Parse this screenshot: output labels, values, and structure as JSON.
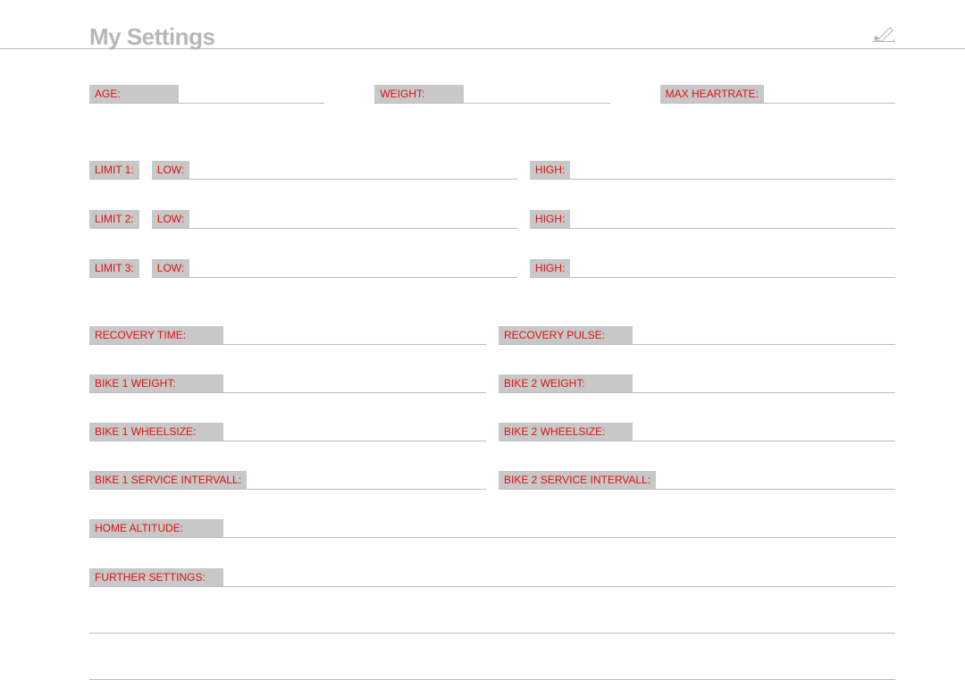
{
  "header": {
    "title": "My Settings"
  },
  "row1": {
    "age": "AGE:",
    "weight": "WEIGHT:",
    "max_hr": "MAX HEARTRATE:"
  },
  "limits": [
    {
      "tag": "LIMIT 1:",
      "low": "LOW:",
      "high": "HIGH:"
    },
    {
      "tag": "LIMIT 2:",
      "low": "LOW:",
      "high": "HIGH:"
    },
    {
      "tag": "LIMIT 3:",
      "low": "LOW:",
      "high": "HIGH:"
    }
  ],
  "recovery": {
    "time": "RECOVERY TIME:",
    "pulse": "RECOVERY PULSE:"
  },
  "bikes": {
    "b1_weight": "BIKE 1 WEIGHT:",
    "b2_weight": "BIKE 2 WEIGHT:",
    "b1_wheel": "BIKE 1 WHEELSIZE:",
    "b2_wheel": "BIKE 2 WHEELSIZE:",
    "b1_service": "BIKE 1 SERVICE INTERVALL:",
    "b2_service": "BIKE 2 SERVICE INTERVALL:"
  },
  "home_altitude": "HOME ALTITUDE:",
  "further": "FURTHER SETTINGS:"
}
